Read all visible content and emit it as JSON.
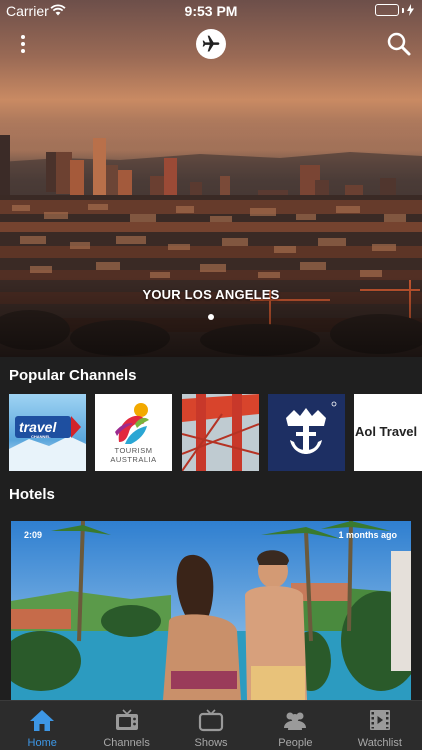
{
  "status_bar": {
    "carrier": "Carrier",
    "time": "9:53 PM",
    "battery_color": "#35d04a"
  },
  "nav": {
    "menu_icon": "more-vertical-icon",
    "logo_icon": "airplane-icon",
    "search_icon": "search-icon"
  },
  "hero": {
    "title": "YOUR LOS ANGELES",
    "page_count": 1,
    "active_page": 0
  },
  "popular_channels": {
    "title": "Popular Channels",
    "items": [
      {
        "name": "travel",
        "subtitle": "CHANNEL"
      },
      {
        "name": "TOURISM",
        "subtitle": "AUSTRALIA"
      },
      {
        "name": "bridge-thumbnail"
      },
      {
        "name": "royal-caribbean-crown-logo"
      },
      {
        "name": "Aol Travel"
      }
    ]
  },
  "hotels": {
    "title": "Hotels",
    "video": {
      "duration": "2:09",
      "age": "1 months ago"
    }
  },
  "tabbar": {
    "accent": "#3d97e6",
    "tabs": [
      {
        "label": "Home",
        "icon": "home-icon",
        "active": true
      },
      {
        "label": "Channels",
        "icon": "tv-icon",
        "active": false
      },
      {
        "label": "Shows",
        "icon": "tv-icon",
        "active": false
      },
      {
        "label": "People",
        "icon": "people-icon",
        "active": false
      },
      {
        "label": "Watchlist",
        "icon": "film-icon",
        "active": false
      }
    ]
  }
}
